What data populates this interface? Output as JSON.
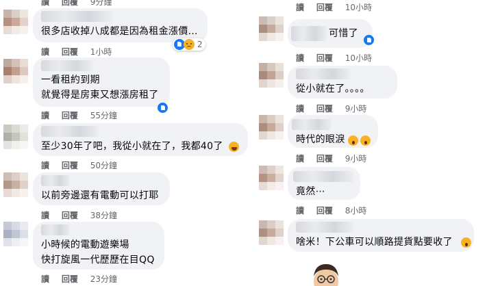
{
  "actions": {
    "reply": "讀",
    "like": "回覆"
  },
  "left_comments": [
    {
      "text": "",
      "time": "9分鐘",
      "top_only": true
    },
    {
      "text": "很多店收掉八成都是因為租金漲價…",
      "time": "1小時",
      "react_count": "2"
    },
    {
      "text": "一看租約到期\n就覺得是房東又想漲房租了",
      "time": "55分鐘"
    },
    {
      "text": "至少30年了吧，我從小就在了，我都40了",
      "time": "50分鐘"
    },
    {
      "text": "以前旁邊還有電動可以打耶",
      "time": "38分鐘"
    },
    {
      "text": "小時候的電動遊樂場\n快打旋風一代歷歷在目QQ",
      "time": "23分鐘"
    }
  ],
  "right_comments": [
    {
      "text": "",
      "time": "10小時",
      "top_only": true
    },
    {
      "text": "可惜了",
      "time": "10小時"
    },
    {
      "text": "從小就在了。。。。",
      "time": "9小時"
    },
    {
      "text": "時代的眼淚",
      "time": "9小時"
    },
    {
      "text": "竟然⋯",
      "time": "8小時"
    },
    {
      "text": "啥米！下公車可以順路提貨點要收了",
      "time": ""
    }
  ]
}
